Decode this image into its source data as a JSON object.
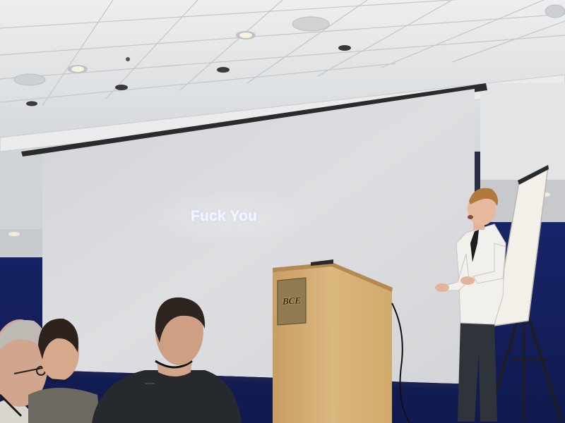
{
  "scene": {
    "description_type": "photograph",
    "colors": {
      "ceiling": "#e2e4e6",
      "screen": "#d8dadd",
      "wall_blue": "#1c2a6e",
      "podium": "#d9b37a",
      "flipchart": "#f2efe8"
    }
  },
  "slide": {
    "text": "Fuck You"
  },
  "podium": {
    "logo_text": "BCE"
  },
  "icons": {
    "microphone": "microphone-icon",
    "laptop": "laptop-icon"
  }
}
